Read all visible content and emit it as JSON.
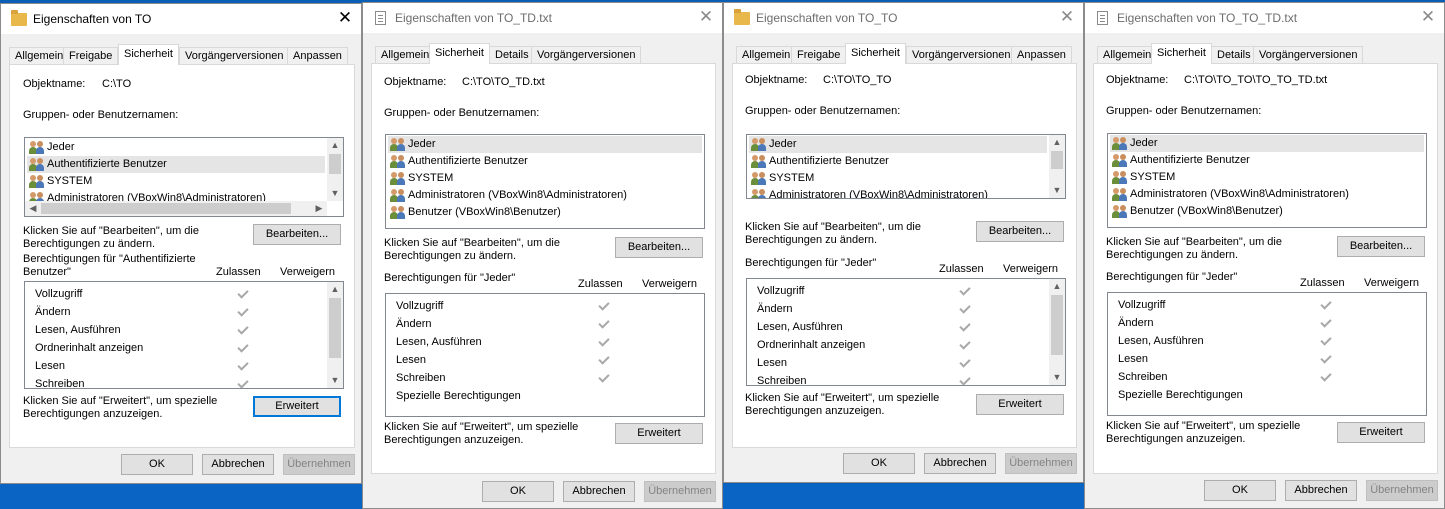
{
  "desktop": {
    "background": "#0a5fb4"
  },
  "windows": [
    {
      "title": "Eigenschaften von TO",
      "icon": "folder-icon",
      "tabs": [
        "Allgemein",
        "Freigabe",
        "Sicherheit",
        "Vorgängerversionen",
        "Anpassen"
      ],
      "selected_tab": "Sicherheit",
      "object_label": "Objektname:",
      "object_value": "C:\\TO",
      "groups_label": "Gruppen- oder Benutzernamen:",
      "users": [
        "Jeder",
        "Authentifizierte Benutzer",
        "SYSTEM",
        "Administratoren (VBoxWin8\\Administratoren)"
      ],
      "selected_user": "Authentifizierte Benutzer",
      "edit_hint": "Klicken Sie auf \"Bearbeiten\", um die Berechtigungen zu ändern.",
      "edit_hint_line1": "Klicken Sie auf \"Bearbeiten\", um die",
      "edit_hint_line2": "Berechtigungen zu ändern.",
      "edit_button": "Bearbeiten...",
      "perm_for_line1": "Berechtigungen für \"Authentifizierte",
      "perm_for_line2": "Benutzer\"",
      "allow_col": "Zulassen",
      "deny_col": "Verweigern",
      "permissions": [
        {
          "name": "Vollzugriff",
          "allow": true
        },
        {
          "name": "Ändern",
          "allow": true
        },
        {
          "name": "Lesen, Ausführen",
          "allow": true
        },
        {
          "name": "Ordnerinhalt anzeigen",
          "allow": true
        },
        {
          "name": "Lesen",
          "allow": true
        },
        {
          "name": "Schreiben",
          "allow": true
        }
      ],
      "adv_hint_line1": "Klicken Sie auf \"Erweitert\", um spezielle",
      "adv_hint_line2": "Berechtigungen anzuzeigen.",
      "advanced_button": "Erweitert",
      "ok": "OK",
      "cancel": "Abbrechen",
      "apply": "Übernehmen"
    },
    {
      "title": "Eigenschaften von TO_TD.txt",
      "icon": "file-icon",
      "tabs": [
        "Allgemein",
        "Sicherheit",
        "Details",
        "Vorgängerversionen"
      ],
      "selected_tab": "Sicherheit",
      "object_label": "Objektname:",
      "object_value": "C:\\TO\\TO_TD.txt",
      "groups_label": "Gruppen- oder Benutzernamen:",
      "users": [
        "Jeder",
        "Authentifizierte Benutzer",
        "SYSTEM",
        "Administratoren (VBoxWin8\\Administratoren)",
        "Benutzer (VBoxWin8\\Benutzer)"
      ],
      "selected_user": "Jeder",
      "edit_hint_line1": "Klicken Sie auf \"Bearbeiten\", um die",
      "edit_hint_line2": "Berechtigungen zu ändern.",
      "edit_button": "Bearbeiten...",
      "perm_for_line1": "Berechtigungen für \"Jeder\"",
      "allow_col": "Zulassen",
      "deny_col": "Verweigern",
      "permissions": [
        {
          "name": "Vollzugriff",
          "allow": true
        },
        {
          "name": "Ändern",
          "allow": true
        },
        {
          "name": "Lesen, Ausführen",
          "allow": true
        },
        {
          "name": "Lesen",
          "allow": true
        },
        {
          "name": "Schreiben",
          "allow": true
        },
        {
          "name": "Spezielle Berechtigungen",
          "allow": false
        }
      ],
      "adv_hint_line1": "Klicken Sie auf \"Erweitert\", um spezielle",
      "adv_hint_line2": "Berechtigungen anzuzeigen.",
      "advanced_button": "Erweitert",
      "ok": "OK",
      "cancel": "Abbrechen",
      "apply": "Übernehmen"
    },
    {
      "title": "Eigenschaften von TO_TO",
      "icon": "folder-icon",
      "tabs": [
        "Allgemein",
        "Freigabe",
        "Sicherheit",
        "Vorgängerversionen",
        "Anpassen"
      ],
      "selected_tab": "Sicherheit",
      "object_label": "Objektname:",
      "object_value": "C:\\TO\\TO_TO",
      "groups_label": "Gruppen- oder Benutzernamen:",
      "users": [
        "Jeder",
        "Authentifizierte Benutzer",
        "SYSTEM",
        "Administratoren (VBoxWin8\\Administratoren)"
      ],
      "selected_user": "Jeder",
      "edit_hint_line1": "Klicken Sie auf \"Bearbeiten\", um die",
      "edit_hint_line2": "Berechtigungen zu ändern.",
      "edit_button": "Bearbeiten...",
      "perm_for_line1": "Berechtigungen für \"Jeder\"",
      "allow_col": "Zulassen",
      "deny_col": "Verweigern",
      "permissions": [
        {
          "name": "Vollzugriff",
          "allow": true
        },
        {
          "name": "Ändern",
          "allow": true
        },
        {
          "name": "Lesen, Ausführen",
          "allow": true
        },
        {
          "name": "Ordnerinhalt anzeigen",
          "allow": true
        },
        {
          "name": "Lesen",
          "allow": true
        },
        {
          "name": "Schreiben",
          "allow": true
        }
      ],
      "adv_hint_line1": "Klicken Sie auf \"Erweitert\", um spezielle",
      "adv_hint_line2": "Berechtigungen anzuzeigen.",
      "advanced_button": "Erweitert",
      "ok": "OK",
      "cancel": "Abbrechen",
      "apply": "Übernehmen"
    },
    {
      "title": "Eigenschaften von TO_TO_TD.txt",
      "icon": "file-icon",
      "tabs": [
        "Allgemein",
        "Sicherheit",
        "Details",
        "Vorgängerversionen"
      ],
      "selected_tab": "Sicherheit",
      "object_label": "Objektname:",
      "object_value": "C:\\TO\\TO_TO\\TO_TO_TD.txt",
      "groups_label": "Gruppen- oder Benutzernamen:",
      "users": [
        "Jeder",
        "Authentifizierte Benutzer",
        "SYSTEM",
        "Administratoren (VBoxWin8\\Administratoren)",
        "Benutzer (VBoxWin8\\Benutzer)"
      ],
      "selected_user": "Jeder",
      "edit_hint_line1": "Klicken Sie auf \"Bearbeiten\", um die",
      "edit_hint_line2": "Berechtigungen zu ändern.",
      "edit_button": "Bearbeiten...",
      "perm_for_line1": "Berechtigungen für \"Jeder\"",
      "allow_col": "Zulassen",
      "deny_col": "Verweigern",
      "permissions": [
        {
          "name": "Vollzugriff",
          "allow": true
        },
        {
          "name": "Ändern",
          "allow": true
        },
        {
          "name": "Lesen, Ausführen",
          "allow": true
        },
        {
          "name": "Lesen",
          "allow": true
        },
        {
          "name": "Schreiben",
          "allow": true
        },
        {
          "name": "Spezielle Berechtigungen",
          "allow": false
        }
      ],
      "adv_hint_line1": "Klicken Sie auf \"Erweitert\", um spezielle",
      "adv_hint_line2": "Berechtigungen anzuzeigen.",
      "advanced_button": "Erweitert",
      "ok": "OK",
      "cancel": "Abbrechen",
      "apply": "Übernehmen"
    }
  ]
}
